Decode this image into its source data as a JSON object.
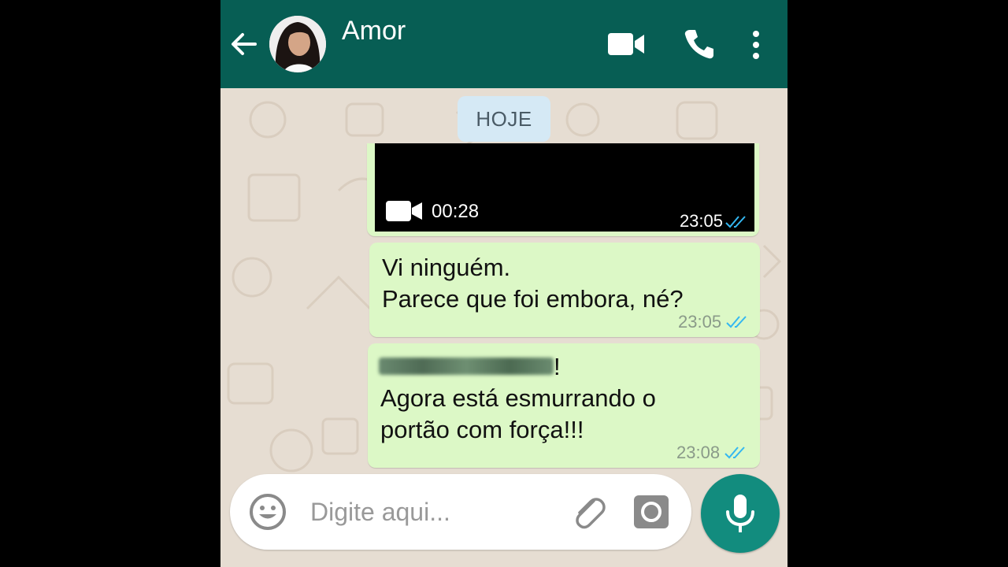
{
  "header": {
    "contact_name": "Amor"
  },
  "date_separator": "HOJE",
  "messages": [
    {
      "type": "video",
      "duration": "00:28",
      "time": "23:05",
      "status": "read"
    },
    {
      "type": "text",
      "lines": [
        "Vi ninguém.",
        "Parece que foi embora, né?"
      ],
      "time": "23:05",
      "status": "read"
    },
    {
      "type": "text",
      "first_line_suffix": "!",
      "lines": [
        "Agora está esmurrando o",
        "portão com força!!!"
      ],
      "time": "23:08",
      "status": "read"
    }
  ],
  "composer": {
    "placeholder": "Digite aqui..."
  },
  "colors": {
    "header": "#075e54",
    "bubble_outgoing": "#dcf8c6",
    "read_ticks": "#34b7f1",
    "mic_button": "#128c7e",
    "wallpaper": "#e6ddd2"
  },
  "icons": [
    "back-arrow-icon",
    "video-call-icon",
    "phone-icon",
    "more-vert-icon",
    "video-camera-icon",
    "double-check-icon",
    "emoji-icon",
    "attach-icon",
    "camera-icon",
    "mic-icon"
  ]
}
